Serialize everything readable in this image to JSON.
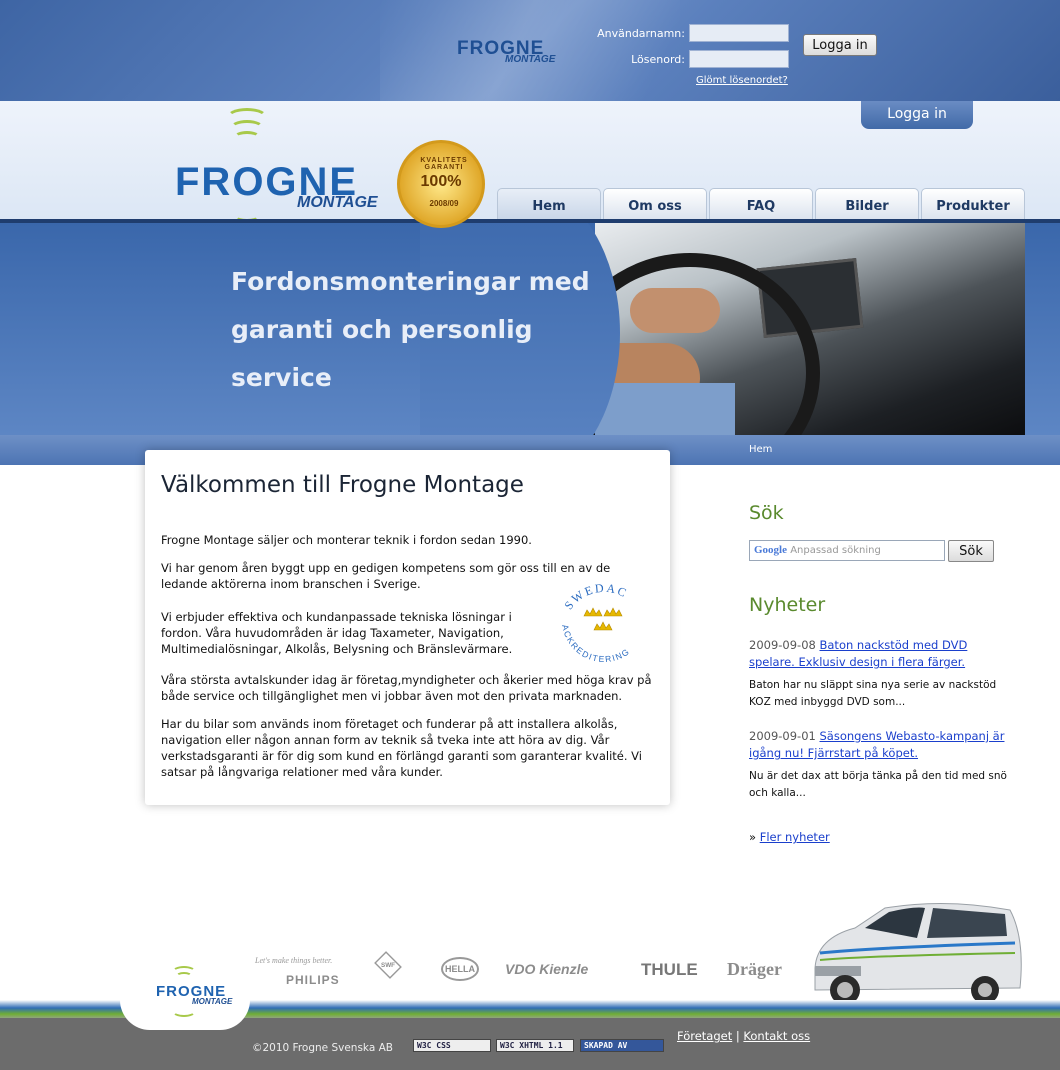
{
  "login": {
    "username_label": "Användarnamn:",
    "password_label": "Lösenord:",
    "button": "Logga in",
    "forgot": "Glömt lösenordet?"
  },
  "brand": {
    "wordmark": "FROGNE",
    "sub": "MONTAGE"
  },
  "login_tab": "Logga in",
  "nav": {
    "tabs": [
      {
        "label": "Hem",
        "active": true
      },
      {
        "label": "Om oss"
      },
      {
        "label": "FAQ"
      },
      {
        "label": "Bilder"
      },
      {
        "label": "Produkter"
      }
    ]
  },
  "hero": {
    "lines": [
      "Fordonsmonteringar med",
      "garanti och personlig",
      "service"
    ],
    "seal": {
      "top": "KVALITETS GARANTI",
      "pct": "100%",
      "year": "2008/09"
    }
  },
  "breadcrumb": "Hem",
  "main": {
    "title": "Välkommen till Frogne Montage",
    "paragraphs": [
      "Frogne Montage säljer och monterar teknik i fordon sedan 1990.",
      "Vi har genom åren byggt upp en gedigen kompetens som gör oss till en av de ledande aktörerna inom branschen i Sverige.",
      "Vi erbjuder effektiva och kundanpassade tekniska lösningar i fordon. Våra huvudområden är idag Taxameter, Navigation, Multimedialösningar, Alkolås, Belysning och Bränslevärmare.",
      "Våra största avtalskunder idag är företag,myndigheter och åkerier med höga krav på både service och tillgänglighet men vi jobbar även mot den privata marknaden.",
      "Har du bilar som används inom företaget och funderar på att installera alkolås, navigation eller någon annan form av teknik så tveka inte att höra av dig. Vår verkstadsgaranti är för dig som kund en förlängd garanti som garanterar kvalité. Vi satsar på långvariga relationer med våra kunder."
    ],
    "swedac": "SWEDAC · ACKREDITERING"
  },
  "sidebar": {
    "search_heading": "Sök",
    "search_google": "Google",
    "search_placeholder": "Anpassad sökning",
    "search_button": "Sök",
    "news_heading": "Nyheter",
    "news": [
      {
        "date": "2009-09-08",
        "title": "Baton nackstöd med DVD spelare. Exklusiv design i flera färger.",
        "desc": "Baton har nu släppt sina nya serie av nackstöd KOZ med inbyggd DVD som..."
      },
      {
        "date": "2009-09-01",
        "title": "Säsongens Webasto-kampanj är igång nu! Fjärrstart på köpet.",
        "desc": "Nu är det dax att börja tänka på den tid med snö och kalla..."
      }
    ],
    "more_prefix": "»",
    "more_news": "Fler nyheter"
  },
  "partners": {
    "philips_tag": "Let's make things better.",
    "philips": "PHILIPS",
    "swf": "SWF",
    "hella": "HELLA",
    "vdo": "VDO Kienzle",
    "thule": "THULE",
    "drager": "Dräger"
  },
  "footer": {
    "copyright": "©2010 Frogne Svenska AB",
    "badges": [
      "W3C CSS",
      "W3C XHTML 1.1",
      "SKAPAD AV"
    ],
    "links": [
      "Företaget",
      "Kontakt oss"
    ],
    "separator": "|"
  },
  "colors": {
    "header_blue": "#3e65a4",
    "nav_dark": "#1f3d6e",
    "heading_green": "#5a8a2e",
    "link_blue": "#1a3fcc",
    "footer_gray": "#6c6c6c"
  }
}
